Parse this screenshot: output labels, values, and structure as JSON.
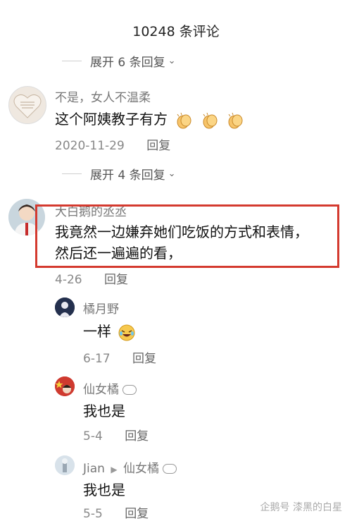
{
  "header": {
    "title": "10248 条评论"
  },
  "expand_top": {
    "label": "展开 6 条回复"
  },
  "comment1": {
    "username": "不是，女人不温柔",
    "text": "这个阿姨教子有方",
    "date": "2020-11-29",
    "reply_label": "回复"
  },
  "expand_mid": {
    "label": "展开 4 条回复"
  },
  "comment2": {
    "username": "大白鹅的丞丞",
    "text_line1": "我竟然一边嫌弃她们吃饭的方式和表情，",
    "text_line2": "然后还一遍遍的看，",
    "date": "4-26",
    "reply_label": "回复"
  },
  "reply1": {
    "username": "橘月野",
    "text": "一样",
    "date": "6-17",
    "reply_label": "回复"
  },
  "reply2": {
    "username": "仙女橘",
    "text": "我也是",
    "date": "5-4",
    "reply_label": "回复"
  },
  "reply3": {
    "username": "Jian",
    "reply_to": "仙女橘",
    "text": "我也是",
    "date": "5-5",
    "reply_label": "回复"
  },
  "watermark": {
    "text": "企鹅号 漆黑的白星"
  },
  "colors": {
    "highlight_border": "#d43a2f",
    "meta_gray": "#888888"
  }
}
